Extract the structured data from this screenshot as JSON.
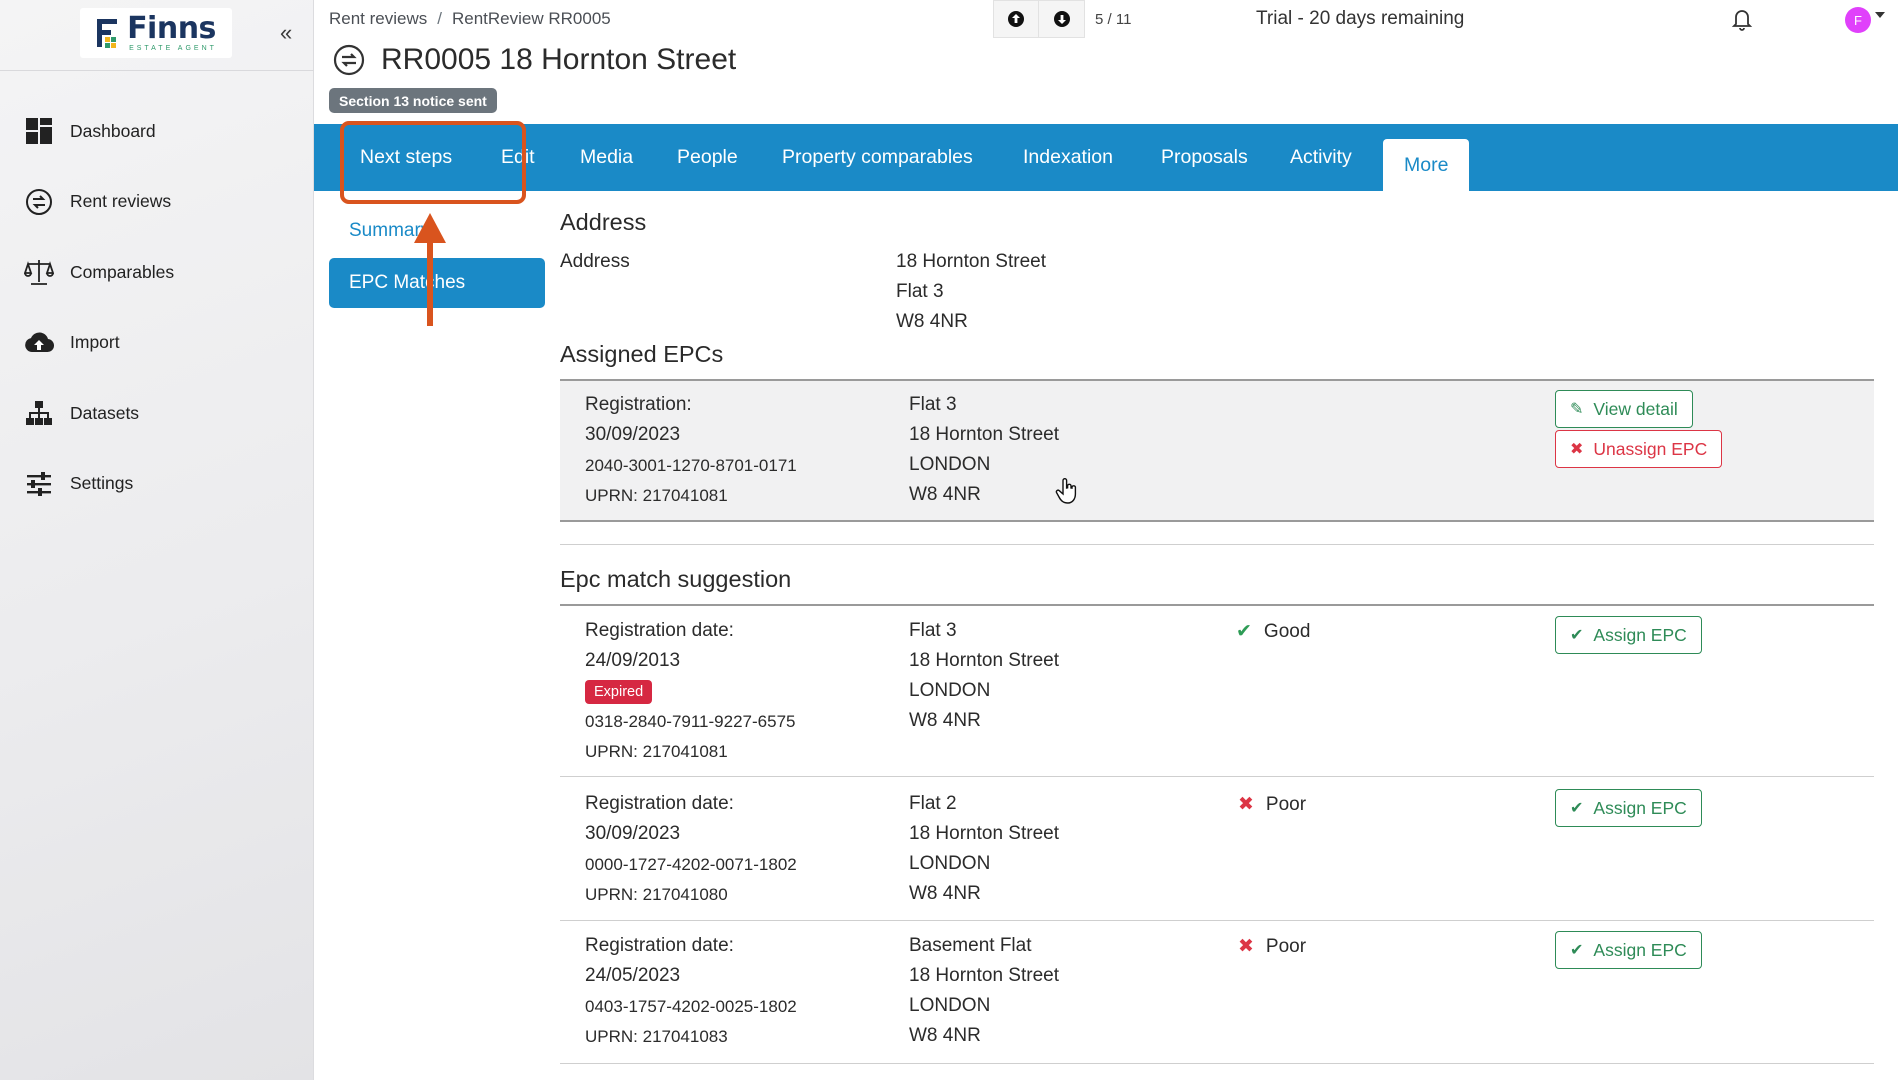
{
  "app": {
    "logo_name": "Finns",
    "logo_sub": "ESTATE AGENT",
    "collapse": "«"
  },
  "sidebar": {
    "items": [
      {
        "label": "Dashboard",
        "icon": "dashboard-icon"
      },
      {
        "label": "Rent reviews",
        "icon": "rent-review-icon"
      },
      {
        "label": "Comparables",
        "icon": "scales-icon"
      },
      {
        "label": "Import",
        "icon": "cloud-upload-icon"
      },
      {
        "label": "Datasets",
        "icon": "hierarchy-icon"
      },
      {
        "label": "Settings",
        "icon": "sliders-icon"
      }
    ]
  },
  "header": {
    "breadcrumb": [
      "Rent reviews",
      "RentReview RR0005"
    ],
    "breadcrumb_sep": "/",
    "pager_count": "5 / 11",
    "trial": "Trial - 20 days remaining",
    "avatar_initial": "F",
    "title": "RR0005 18 Hornton Street",
    "status_badge": "Section 13 notice sent"
  },
  "tabs": [
    "Next steps",
    "Edit",
    "Media",
    "People",
    "Property comparables",
    "Indexation",
    "Proposals",
    "Activity",
    "More"
  ],
  "active_tab": "More",
  "subnav": {
    "summary": "Summary",
    "epc_matches": "EPC Matches"
  },
  "address": {
    "heading": "Address",
    "label": "Address",
    "lines": [
      "18 Hornton Street",
      "Flat 3",
      "W8 4NR"
    ]
  },
  "assigned": {
    "heading": "Assigned EPCs",
    "registration_label": "Registration:",
    "date": "30/09/2023",
    "cert": "2040-3001-1270-8701-0171",
    "uprn": "UPRN: 217041081",
    "addr": [
      "Flat 3",
      "18 Hornton Street",
      "LONDON",
      "W8 4NR"
    ],
    "view_btn": "View detail",
    "unassign_btn": "Unassign EPC"
  },
  "suggestions": {
    "heading": "Epc match suggestion",
    "date_label": "Registration date:",
    "assign_btn": "Assign EPC",
    "expired_label": "Expired",
    "rows": [
      {
        "date": "24/09/2013",
        "expired": true,
        "cert": "0318-2840-7911-9227-6575",
        "uprn": "UPRN: 217041081",
        "addr": [
          "Flat 3",
          "18 Hornton Street",
          "LONDON",
          "W8 4NR"
        ],
        "rating": "Good",
        "rating_mark": "✔"
      },
      {
        "date": "30/09/2023",
        "expired": false,
        "cert": "0000-1727-4202-0071-1802",
        "uprn": "UPRN: 217041080",
        "addr": [
          "Flat 2",
          "18 Hornton Street",
          "LONDON",
          "W8 4NR"
        ],
        "rating": "Poor",
        "rating_mark": "✖"
      },
      {
        "date": "24/05/2023",
        "expired": false,
        "cert": "0403-1757-4202-0025-1802",
        "uprn": "UPRN: 217041083",
        "addr": [
          "Basement Flat",
          "18 Hornton Street",
          "LONDON",
          "W8 4NR"
        ],
        "rating": "Poor",
        "rating_mark": "✖"
      }
    ]
  },
  "colors": {
    "accent": "#1a8ac7",
    "annotation": "#d9541e",
    "good": "#2e9c56",
    "danger": "#dc3545",
    "badge_gray": "#6c757d"
  }
}
